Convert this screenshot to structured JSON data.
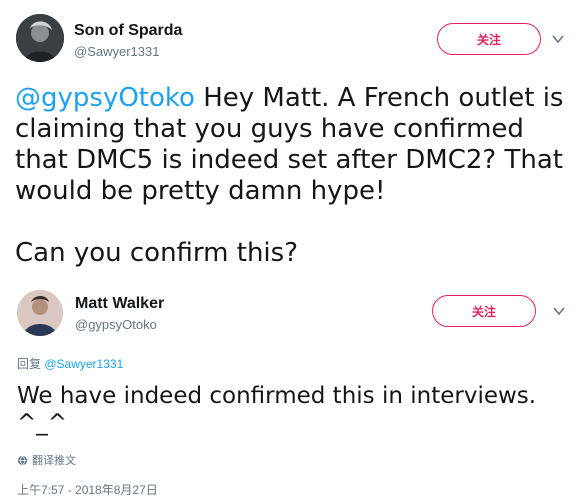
{
  "tweet": {
    "author": {
      "name": "Son of Sparda",
      "handle": "@Sawyer1331"
    },
    "follow_label": "关注",
    "text_mention": "@gypsyOtoko",
    "text_body": " Hey Matt. A French outlet is claiming that you guys have confirmed that DMC5 is indeed set after DMC2? That would be pretty damn hype!",
    "text_question": "Can you confirm this?"
  },
  "reply": {
    "author": {
      "name": "Matt Walker",
      "handle": "@gypsyOtoko"
    },
    "follow_label": "关注",
    "replying_prefix": "回复",
    "replying_to": "@Sawyer1331",
    "text": "We have indeed confirmed this in interviews. ^_^",
    "translate_label": "翻译推文",
    "timestamp": "上午7:57 - 2018年8月27日"
  },
  "colors": {
    "accent_follow": "#e0245e",
    "mention": "#1da1f2",
    "secondary_text": "#657786"
  }
}
